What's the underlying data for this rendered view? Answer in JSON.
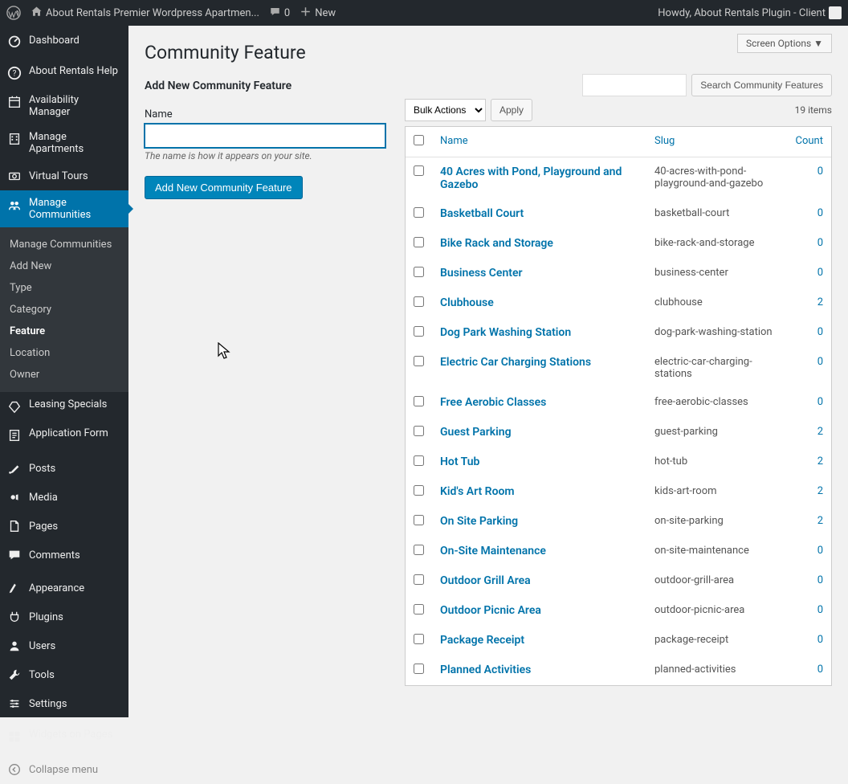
{
  "adminbar": {
    "site_title": "About Rentals Premier Wordpress Apartmen...",
    "comments_count": "0",
    "new_label": "New",
    "howdy": "Howdy, About Rentals Plugin - Client"
  },
  "sidebar": {
    "items": [
      {
        "label": "Dashboard",
        "icon": "dashboard"
      },
      {
        "label": "About Rentals Help",
        "icon": "help"
      },
      {
        "label": "Availability Manager",
        "icon": "availability"
      },
      {
        "label": "Manage Apartments",
        "icon": "apartments"
      },
      {
        "label": "Virtual Tours",
        "icon": "tours"
      },
      {
        "label": "Manage Communities",
        "icon": "communities",
        "current": true
      },
      {
        "label": "Leasing Specials",
        "icon": "specials"
      },
      {
        "label": "Application Form",
        "icon": "form"
      },
      {
        "label": "Posts",
        "icon": "posts"
      },
      {
        "label": "Media",
        "icon": "media"
      },
      {
        "label": "Pages",
        "icon": "pages"
      },
      {
        "label": "Comments",
        "icon": "comments"
      },
      {
        "label": "Appearance",
        "icon": "appearance"
      },
      {
        "label": "Plugins",
        "icon": "plugins"
      },
      {
        "label": "Users",
        "icon": "users"
      },
      {
        "label": "Tools",
        "icon": "tools"
      },
      {
        "label": "Settings",
        "icon": "settings"
      },
      {
        "label": "Widgets on Pages",
        "icon": "widgets"
      },
      {
        "label": "Collapse menu",
        "icon": "collapse"
      }
    ],
    "submenu": [
      {
        "label": "Manage Communities"
      },
      {
        "label": "Add New"
      },
      {
        "label": "Type"
      },
      {
        "label": "Category"
      },
      {
        "label": "Feature",
        "active": true
      },
      {
        "label": "Location"
      },
      {
        "label": "Owner"
      }
    ]
  },
  "screen_options": "Screen Options  ▼",
  "page_title": "Community Feature",
  "search": {
    "button": "Search Community Features"
  },
  "form": {
    "heading": "Add New Community Feature",
    "name_label": "Name",
    "name_desc": "The name is how it appears on your site.",
    "submit": "Add New Community Feature"
  },
  "table": {
    "bulk_placeholder": "Bulk Actions",
    "apply": "Apply",
    "items_count": "19 items",
    "columns": {
      "name": "Name",
      "slug": "Slug",
      "count": "Count"
    },
    "rows": [
      {
        "name": "40 Acres with Pond, Playground and Gazebo",
        "slug": "40-acres-with-pond-playground-and-gazebo",
        "count": "0"
      },
      {
        "name": "Basketball Court",
        "slug": "basketball-court",
        "count": "0"
      },
      {
        "name": "Bike Rack and Storage",
        "slug": "bike-rack-and-storage",
        "count": "0"
      },
      {
        "name": "Business Center",
        "slug": "business-center",
        "count": "0"
      },
      {
        "name": "Clubhouse",
        "slug": "clubhouse",
        "count": "2"
      },
      {
        "name": "Dog Park Washing Station",
        "slug": "dog-park-washing-station",
        "count": "0"
      },
      {
        "name": "Electric Car Charging Stations",
        "slug": "electric-car-charging-stations",
        "count": "0"
      },
      {
        "name": "Free Aerobic Classes",
        "slug": "free-aerobic-classes",
        "count": "0"
      },
      {
        "name": "Guest Parking",
        "slug": "guest-parking",
        "count": "2"
      },
      {
        "name": "Hot Tub",
        "slug": "hot-tub",
        "count": "2"
      },
      {
        "name": "Kid's Art Room",
        "slug": "kids-art-room",
        "count": "2"
      },
      {
        "name": "On Site Parking",
        "slug": "on-site-parking",
        "count": "2"
      },
      {
        "name": "On-Site Maintenance",
        "slug": "on-site-maintenance",
        "count": "0"
      },
      {
        "name": "Outdoor Grill Area",
        "slug": "outdoor-grill-area",
        "count": "0"
      },
      {
        "name": "Outdoor Picnic Area",
        "slug": "outdoor-picnic-area",
        "count": "0"
      },
      {
        "name": "Package Receipt",
        "slug": "package-receipt",
        "count": "0"
      },
      {
        "name": "Planned Activities",
        "slug": "planned-activities",
        "count": "0"
      }
    ]
  }
}
